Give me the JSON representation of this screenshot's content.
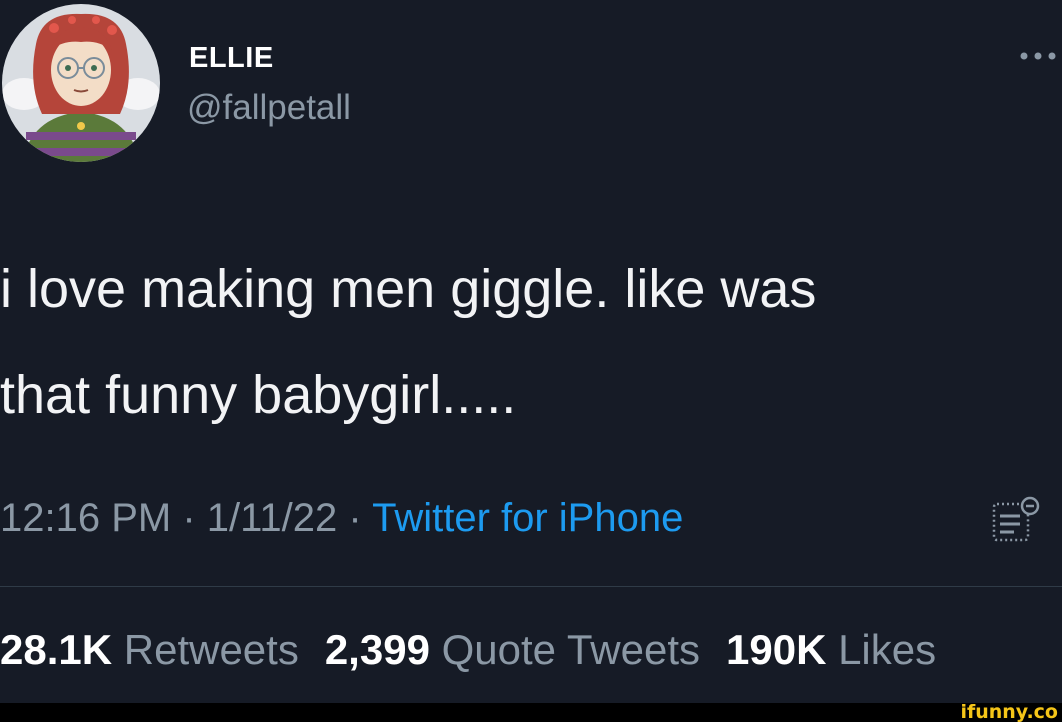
{
  "tweet": {
    "author": {
      "display_name": "ELLIE",
      "handle": "@fallpetall"
    },
    "text": "i love making men giggle. like was\nthat funny babygirl.....",
    "meta": {
      "time": "12:16 PM",
      "separator": " · ",
      "date": "1/11/22",
      "source": "Twitter for iPhone"
    },
    "stats": {
      "retweets_count": "28.1K",
      "retweets_label": "Retweets",
      "quotes_count": "2,399",
      "quotes_label": "Quote Tweets",
      "likes_count": "190K",
      "likes_label": "Likes"
    },
    "icons": {
      "more": "more-horizontal-icon",
      "analytics": "analytics-icon",
      "avatar": "avatar-image"
    }
  },
  "watermark": {
    "text": "ifunny.co"
  },
  "colors": {
    "background": "#161b26",
    "text": "#f2f3f5",
    "secondary_text": "#8b98a5",
    "link": "#1d9bf0",
    "divider": "#2f3b47",
    "watermark": "#f5c518"
  }
}
